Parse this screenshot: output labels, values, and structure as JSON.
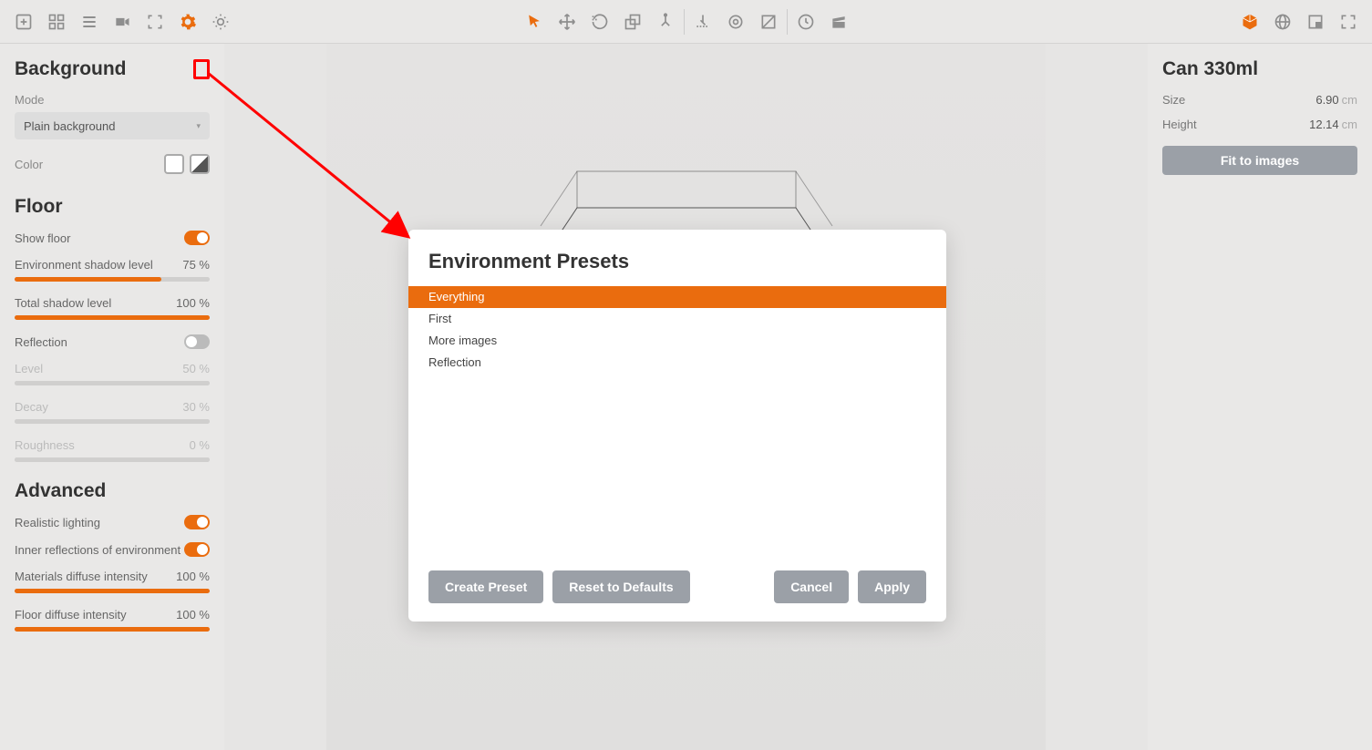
{
  "toolbar": {
    "left": [
      "add",
      "grid",
      "list",
      "camera",
      "focus",
      "settings",
      "light"
    ],
    "center": [
      "cursor",
      "move",
      "rotate",
      "scale",
      "pivot"
    ],
    "center2": [
      "drop",
      "target",
      "fade"
    ],
    "center3": [
      "time",
      "clapper"
    ],
    "right": [
      "cube",
      "globe",
      "window",
      "fullscreen"
    ]
  },
  "left": {
    "background": {
      "title": "Background",
      "mode_label": "Mode",
      "mode_value": "Plain background",
      "color_label": "Color"
    },
    "floor": {
      "title": "Floor",
      "show_floor_label": "Show floor",
      "show_floor": true,
      "env_shadow_label": "Environment shadow level",
      "env_shadow_value": "75 %",
      "env_shadow_pct": 75,
      "total_shadow_label": "Total shadow level",
      "total_shadow_value": "100 %",
      "total_shadow_pct": 100,
      "reflection_label": "Reflection",
      "reflection": false,
      "level_label": "Level",
      "level_value": "50 %",
      "decay_label": "Decay",
      "decay_value": "30 %",
      "roughness_label": "Roughness",
      "roughness_value": "0 %"
    },
    "advanced": {
      "title": "Advanced",
      "realistic_label": "Realistic lighting",
      "realistic": true,
      "inner_refl_label": "Inner reflections of environment",
      "inner_refl": true,
      "mat_diff_label": "Materials diffuse intensity",
      "mat_diff_value": "100 %",
      "mat_diff_pct": 100,
      "floor_diff_label": "Floor diffuse intensity",
      "floor_diff_value": "100 %",
      "floor_diff_pct": 100
    }
  },
  "right": {
    "title": "Can 330ml",
    "size_label": "Size",
    "size_value": "6.90",
    "size_unit": "cm",
    "height_label": "Height",
    "height_value": "12.14",
    "height_unit": "cm",
    "fit_label": "Fit to images"
  },
  "dialog": {
    "title": "Environment Presets",
    "presets": [
      "Everything",
      "First",
      "More images",
      "Reflection"
    ],
    "selected": 0,
    "create_label": "Create Preset",
    "reset_label": "Reset to Defaults",
    "cancel_label": "Cancel",
    "apply_label": "Apply"
  }
}
